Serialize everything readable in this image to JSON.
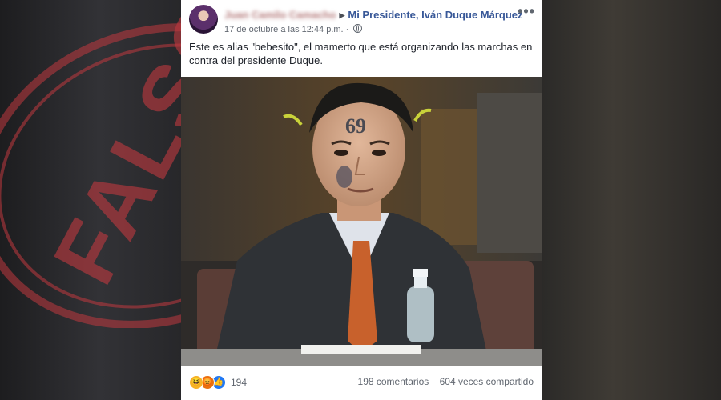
{
  "post": {
    "author_name": "Juan Camilo Camacho",
    "page_name": "Mi Presidente, Iván Duque Márquez",
    "timestamp": "17 de octubre a las 12:44 p.m.",
    "privacy_icon": "globe-icon",
    "text": "Este es alias \"bebesito\", el mamerto que está organizando las marchas en contra del presidente Duque.",
    "more_icon": "•••"
  },
  "photo": {
    "tattoo_text": "69"
  },
  "engagement": {
    "reaction_icons": [
      "haha-reaction-icon",
      "angry-reaction-icon",
      "like-reaction-icon"
    ],
    "reaction_count": "194",
    "comments": "198 comentarios",
    "shares": "604 veces compartido"
  },
  "overlay": {
    "stamp_text": "FALSO",
    "stamp_color": "#c0393f"
  },
  "colors": {
    "link": "#385898",
    "text": "#1d2129",
    "meta": "#616770"
  }
}
